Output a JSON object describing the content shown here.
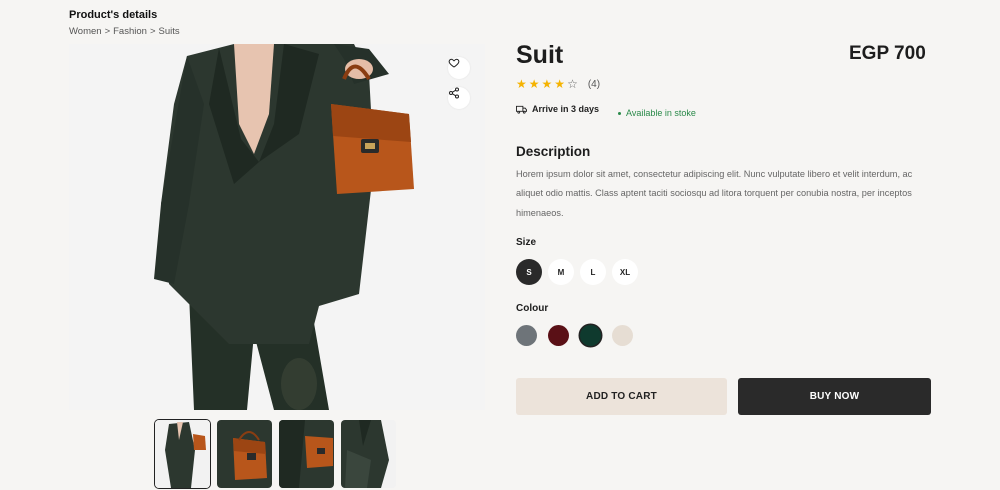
{
  "header": {
    "title": "Product's details",
    "breadcrumb": [
      "Women",
      "Fashion",
      "Suits"
    ],
    "breadcrumb_separator": ">"
  },
  "gallery": {
    "actions": [
      {
        "icon": "heart-icon"
      },
      {
        "icon": "share-icon"
      }
    ],
    "thumbnails": [
      {
        "alt": "Suit full view",
        "active": true
      },
      {
        "alt": "Bag close-up",
        "active": false
      },
      {
        "alt": "Bag detail",
        "active": false
      },
      {
        "alt": "Suit side view",
        "active": false
      }
    ]
  },
  "product": {
    "name": "Suit",
    "price": "EGP 700",
    "rating": 4,
    "rating_max": 5,
    "review_count": "(4)",
    "delivery": "Arrive in 3 days",
    "delivery_icon": "truck-icon",
    "stock": "Available in stoke"
  },
  "description": {
    "title": "Description",
    "text": "Horem ipsum dolor sit amet, consectetur adipiscing elit. Nunc vulputate libero et velit interdum, ac aliquet odio mattis. Class aptent taciti sociosqu ad litora torquent per conubia nostra, per inceptos himenaeos."
  },
  "size": {
    "title": "Size",
    "options": [
      "S",
      "M",
      "L",
      "XL"
    ],
    "selected": "S"
  },
  "colour": {
    "title": "Colour",
    "options": [
      "#6e7479",
      "#5a1016",
      "#0f3a2e",
      "#e6ddd3"
    ],
    "selected": "#0f3a2e"
  },
  "actions": {
    "add_to_cart": "ADD TO CART",
    "buy_now": "BUY NOW"
  }
}
